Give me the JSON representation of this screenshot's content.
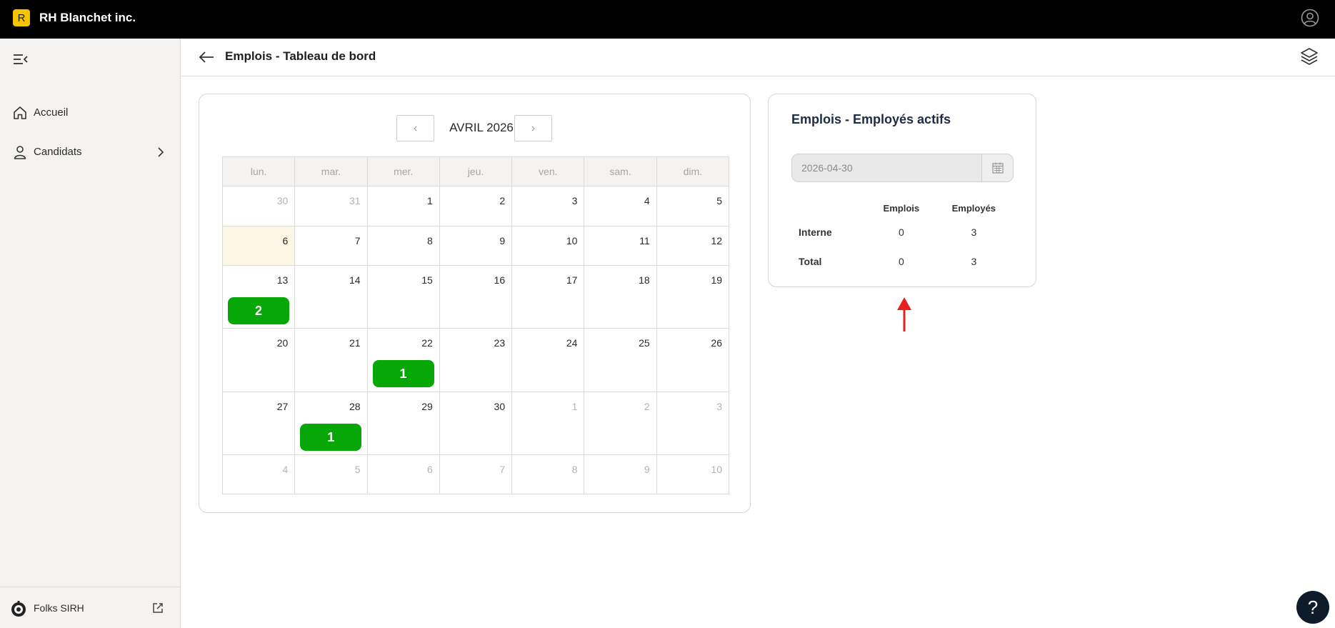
{
  "app": {
    "brand_initial": "R",
    "brand_name": "RH Blanchet inc."
  },
  "sidebar": {
    "items": [
      {
        "label": "Accueil",
        "icon": "home-icon"
      },
      {
        "label": "Candidats",
        "icon": "user-icon"
      }
    ],
    "footer": {
      "label": "Folks SIRH"
    }
  },
  "header": {
    "title": "Emplois - Tableau de bord"
  },
  "calendar": {
    "month_label": "AVRIL 2026",
    "prev_label": "‹",
    "next_label": "›",
    "weekdays": [
      "lun.",
      "mar.",
      "mer.",
      "jeu.",
      "ven.",
      "sam.",
      "dim."
    ],
    "weeks": [
      [
        {
          "d": "30",
          "o": true
        },
        {
          "d": "31",
          "o": true
        },
        {
          "d": "1"
        },
        {
          "d": "2"
        },
        {
          "d": "3"
        },
        {
          "d": "4"
        },
        {
          "d": "5"
        }
      ],
      [
        {
          "d": "6",
          "today": true
        },
        {
          "d": "7"
        },
        {
          "d": "8"
        },
        {
          "d": "9"
        },
        {
          "d": "10"
        },
        {
          "d": "11"
        },
        {
          "d": "12"
        }
      ],
      [
        {
          "d": "13",
          "event": "2"
        },
        {
          "d": "14"
        },
        {
          "d": "15"
        },
        {
          "d": "16"
        },
        {
          "d": "17"
        },
        {
          "d": "18"
        },
        {
          "d": "19"
        }
      ],
      [
        {
          "d": "20"
        },
        {
          "d": "21"
        },
        {
          "d": "22",
          "event": "1"
        },
        {
          "d": "23"
        },
        {
          "d": "24"
        },
        {
          "d": "25"
        },
        {
          "d": "26"
        }
      ],
      [
        {
          "d": "27"
        },
        {
          "d": "28",
          "event": "1"
        },
        {
          "d": "29"
        },
        {
          "d": "30"
        },
        {
          "d": "1",
          "o": true
        },
        {
          "d": "2",
          "o": true
        },
        {
          "d": "3",
          "o": true
        }
      ],
      [
        {
          "d": "4",
          "o": true
        },
        {
          "d": "5",
          "o": true
        },
        {
          "d": "6",
          "o": true
        },
        {
          "d": "7",
          "o": true
        },
        {
          "d": "8",
          "o": true
        },
        {
          "d": "9",
          "o": true
        },
        {
          "d": "10",
          "o": true
        }
      ]
    ]
  },
  "active_employees": {
    "title": "Emplois - Employés actifs",
    "date_value": "2026-04-30",
    "columns": [
      "Emplois",
      "Employés"
    ],
    "rows": [
      {
        "label": "Interne",
        "emplois": "0",
        "employes": "3"
      },
      {
        "label": "Total",
        "emplois": "0",
        "employes": "3"
      }
    ]
  },
  "help": {
    "label": "?"
  },
  "colors": {
    "brand": "#f7c400",
    "event": "#07a707",
    "annotation_arrow": "#e5201e",
    "today_bg": "#fdf8e5"
  }
}
